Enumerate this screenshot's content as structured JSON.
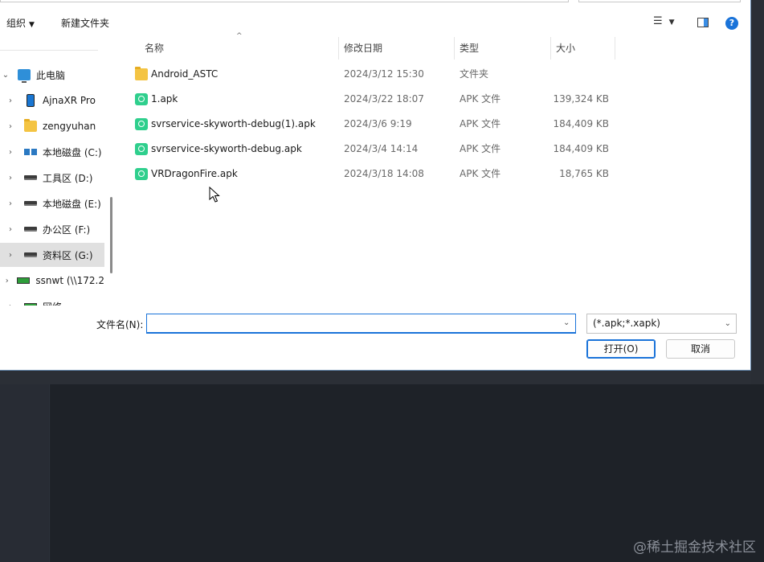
{
  "toolbar": {
    "organize_label": "组织",
    "new_folder_label": "新建文件夹"
  },
  "nav": {
    "items": [
      {
        "label": "此电脑"
      },
      {
        "label": "AjnaXR Pro"
      },
      {
        "label": "zengyuhan"
      },
      {
        "label": "本地磁盘 (C:)"
      },
      {
        "label": "工具区 (D:)"
      },
      {
        "label": "本地磁盘 (E:)"
      },
      {
        "label": "办公区 (F:)"
      },
      {
        "label": "资料区 (G:)"
      },
      {
        "label": "ssnwt (\\\\172.2"
      },
      {
        "label": "网络"
      }
    ]
  },
  "list": {
    "columns": [
      "名称",
      "修改日期",
      "类型",
      "大小"
    ],
    "rows": [
      {
        "name": "Android_ASTC",
        "date": "2024/3/12 15:30",
        "type": "文件夹",
        "size": ""
      },
      {
        "name": "1.apk",
        "date": "2024/3/22 18:07",
        "type": "APK 文件",
        "size": "139,324 KB"
      },
      {
        "name": "svrservice-skyworth-debug(1).apk",
        "date": "2024/3/6 9:19",
        "type": "APK 文件",
        "size": "184,409 KB"
      },
      {
        "name": "svrservice-skyworth-debug.apk",
        "date": "2024/3/4 14:14",
        "type": "APK 文件",
        "size": "184,409 KB"
      },
      {
        "name": "VRDragonFire.apk",
        "date": "2024/3/18 14:08",
        "type": "APK 文件",
        "size": "18,765 KB"
      }
    ]
  },
  "footer": {
    "filename_label": "文件名(N):",
    "filename_value": "",
    "filter_value": "(*.apk;*.xapk)",
    "open_label": "打开(O)",
    "cancel_label": "取消"
  },
  "watermark": "@稀土掘金技术社区"
}
